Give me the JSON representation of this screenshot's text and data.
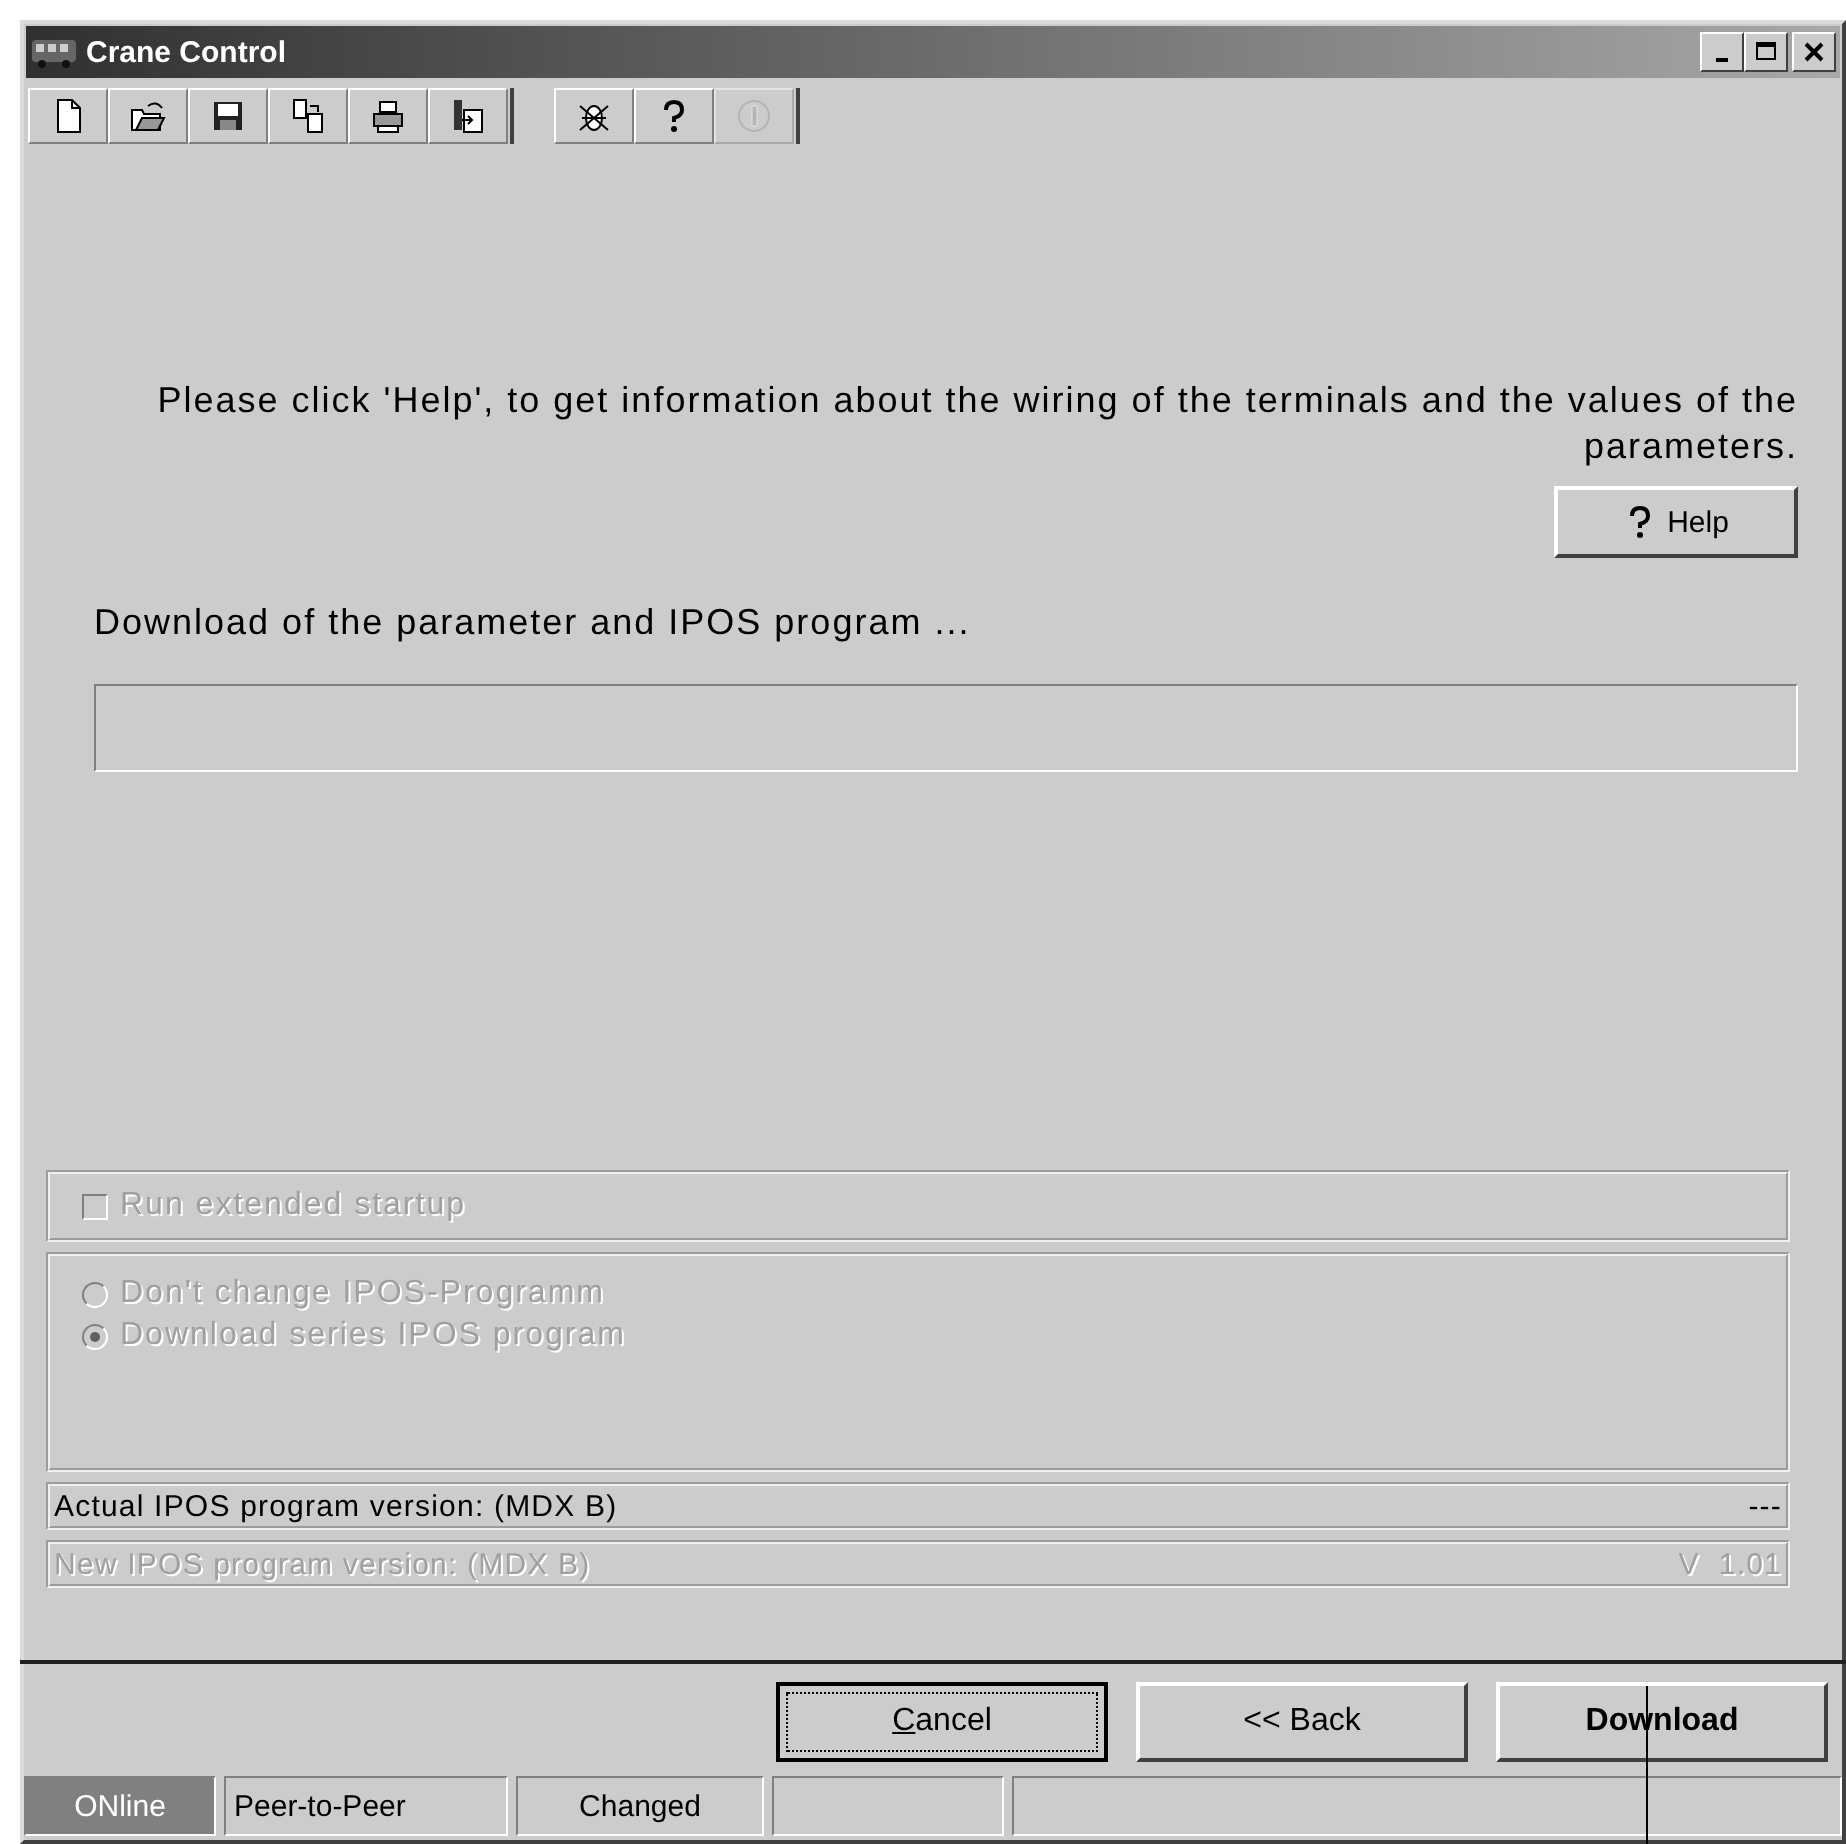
{
  "window": {
    "title": "Crane Control"
  },
  "toolbar": {
    "groups": [
      [
        {
          "kind": "new",
          "disabled": false
        },
        {
          "kind": "open",
          "disabled": false
        },
        {
          "kind": "save",
          "disabled": false
        },
        {
          "kind": "copy",
          "disabled": false
        },
        {
          "kind": "print",
          "disabled": false
        },
        {
          "kind": "export",
          "disabled": false
        }
      ],
      [
        {
          "kind": "bug",
          "disabled": false
        },
        {
          "kind": "help",
          "disabled": false
        },
        {
          "kind": "info",
          "disabled": true
        }
      ]
    ]
  },
  "help_text": "Please click 'Help', to get information about the wiring of the terminals and the values of the parameters.",
  "help_button": {
    "label": "Help"
  },
  "progress": {
    "label": "Download of the parameter and IPOS program ...",
    "level": 0
  },
  "extended_startup": {
    "label": "Run extended startup",
    "checked": false,
    "disabled": true
  },
  "program_options": [
    {
      "label": "Don't change IPOS-Programm",
      "selected": false,
      "disabled": true
    },
    {
      "label": "Download series IPOS program",
      "selected": true,
      "disabled": true
    }
  ],
  "versions": [
    {
      "label": "Actual IPOS program version: (MDX B)",
      "value": "---",
      "disabled": false
    },
    {
      "label": "New IPOS program version: (MDX B)",
      "value": "V  1.01",
      "disabled": true
    }
  ],
  "buttons": [
    {
      "label": "Cancel",
      "mnemonic": true,
      "focused": true,
      "default": false
    },
    {
      "label": "<< Back",
      "mnemonic": false,
      "focused": false,
      "default": false
    },
    {
      "label": "Download",
      "mnemonic": false,
      "focused": false,
      "default": true
    }
  ],
  "status_bar": [
    {
      "text": "ONline",
      "highlighted": true
    },
    {
      "text": "Peer-to-Peer",
      "highlighted": false
    },
    {
      "text": "Changed",
      "highlighted": false
    },
    {
      "highlighted": false
    },
    {
      "highlighted": false
    }
  ]
}
